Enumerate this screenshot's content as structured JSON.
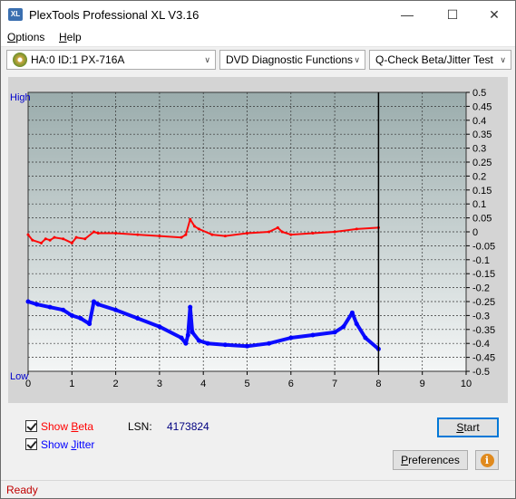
{
  "window": {
    "title": "PlexTools Professional XL V3.16",
    "icon_text": "XL",
    "minimize_glyph": "—",
    "maximize_glyph": "☐",
    "close_glyph": "✕"
  },
  "menu": {
    "items": [
      {
        "label": "Options",
        "accel": "O",
        "rest": "ptions"
      },
      {
        "label": "Help",
        "accel": "H",
        "rest": "elp"
      }
    ]
  },
  "toolbar": {
    "drive": "HA:0 ID:1  PX-716A",
    "function": "DVD Diagnostic Functions",
    "test": "Q-Check Beta/Jitter Test",
    "dropdown_glyph": "∨"
  },
  "chart_labels": {
    "high": "High",
    "low": "Low"
  },
  "chart_data": {
    "type": "line",
    "xlabel": "",
    "ylabel": "",
    "xlim": [
      0,
      10
    ],
    "ylim": [
      -0.5,
      0.5
    ],
    "x_ticks": [
      "0",
      "1",
      "2",
      "3",
      "4",
      "5",
      "6",
      "7",
      "8",
      "9",
      "10"
    ],
    "y_ticks": [
      "0.5",
      "0.45",
      "0.4",
      "0.35",
      "0.3",
      "0.25",
      "0.2",
      "0.15",
      "0.1",
      "0.05",
      "0",
      "-0.05",
      "-0.1",
      "-0.15",
      "-0.2",
      "-0.25",
      "-0.3",
      "-0.35",
      "-0.4",
      "-0.45",
      "-0.5"
    ],
    "grid": true,
    "end_marker_x": 8.0,
    "series": [
      {
        "color": "#ff0000",
        "x": [
          0,
          0.1,
          0.3,
          0.4,
          0.5,
          0.6,
          0.8,
          1.0,
          1.1,
          1.3,
          1.5,
          1.6,
          2.0,
          2.5,
          3.0,
          3.5,
          3.6,
          3.7,
          3.8,
          3.9,
          4.2,
          4.5,
          5.0,
          5.5,
          5.7,
          5.8,
          6.0,
          6.5,
          7.0,
          7.5,
          8.0
        ],
        "y": [
          -0.01,
          -0.03,
          -0.04,
          -0.025,
          -0.03,
          -0.02,
          -0.025,
          -0.04,
          -0.02,
          -0.025,
          0.0,
          -0.005,
          -0.005,
          -0.01,
          -0.015,
          -0.02,
          -0.01,
          0.045,
          0.02,
          0.01,
          -0.01,
          -0.015,
          -0.005,
          0.0,
          0.015,
          0.0,
          -0.01,
          -0.005,
          0.0,
          0.01,
          0.015
        ]
      },
      {
        "color": "#0000ff",
        "x": [
          0,
          0.2,
          0.5,
          0.8,
          1.0,
          1.2,
          1.4,
          1.5,
          1.6,
          2.0,
          2.5,
          3.0,
          3.5,
          3.6,
          3.65,
          3.7,
          3.75,
          3.9,
          4.1,
          4.5,
          5.0,
          5.5,
          6.0,
          6.5,
          7.0,
          7.2,
          7.4,
          7.5,
          7.7,
          8.0
        ],
        "y": [
          -0.25,
          -0.26,
          -0.27,
          -0.28,
          -0.3,
          -0.31,
          -0.33,
          -0.25,
          -0.26,
          -0.28,
          -0.31,
          -0.34,
          -0.38,
          -0.4,
          -0.37,
          -0.27,
          -0.36,
          -0.39,
          -0.4,
          -0.405,
          -0.41,
          -0.4,
          -0.38,
          -0.37,
          -0.36,
          -0.34,
          -0.29,
          -0.33,
          -0.38,
          -0.42
        ]
      }
    ]
  },
  "options": {
    "show_beta": {
      "label": "Show Beta",
      "pre": "Show ",
      "accel": "B",
      "rest": "eta",
      "checked": true
    },
    "show_jitter": {
      "label": "Show Jitter",
      "pre": "Show ",
      "accel": "J",
      "rest": "itter",
      "checked": true
    }
  },
  "lsn": {
    "label": "LSN:",
    "value": "4173824"
  },
  "buttons": {
    "start": {
      "label": "Start",
      "accel": "S",
      "rest": "tart"
    },
    "preferences": {
      "label": "Preferences",
      "accel": "P",
      "rest": "references"
    },
    "info_glyph": "i"
  },
  "status": {
    "text": "Ready"
  },
  "colors": {
    "beta": "#ff0000",
    "jitter": "#0000ff",
    "accent": "#0078d7"
  }
}
